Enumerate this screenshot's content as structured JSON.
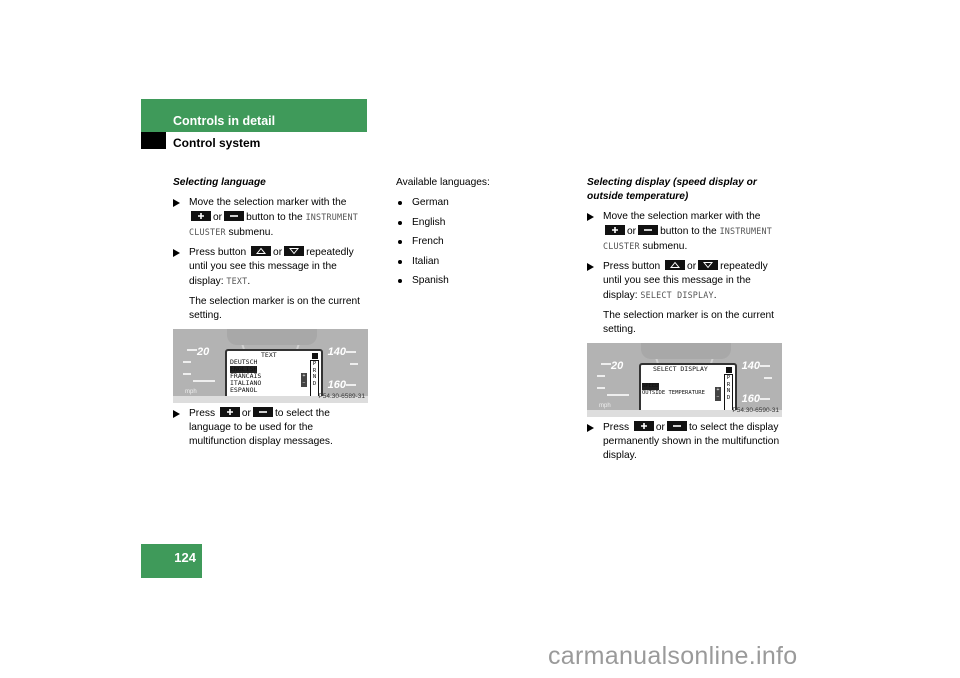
{
  "header": {
    "section_title": "Controls in detail",
    "subsection_title": "Control system"
  },
  "page_number": "124",
  "colors": {
    "accent_green": "#3f9a5a"
  },
  "left_column": {
    "heading": "Selecting language",
    "step1": {
      "pre": "Move the selection marker with the",
      "or": "or",
      "post": "button to the",
      "mono": "INSTRUMENT CLUSTER",
      "tail": "submenu."
    },
    "step2": {
      "pre": "Press button",
      "or": "or",
      "post": "repeatedly until you see this message in the display:",
      "mono": "TEXT",
      "tail": "."
    },
    "note": "The selection marker is on the current setting.",
    "figure": {
      "speed_20": "20",
      "speed_140": "140",
      "speed_160": "160",
      "unit": "mph",
      "display_title": "TEXT",
      "options": [
        "DEUTSCH",
        "ENGLISH",
        "FRANCAIS",
        "ITALIANO",
        "ESPANOL"
      ],
      "selected_option": "ENGLISH",
      "gear": [
        "P",
        "R",
        "N",
        "D"
      ],
      "code": "P54.30-6589-31"
    },
    "step3": {
      "pre": "Press",
      "or": "or",
      "post": "to select the language to be used for the multifunction display messages."
    }
  },
  "middle_column": {
    "heading": "Available languages:",
    "languages": [
      "German",
      "English",
      "French",
      "Italian",
      "Spanish"
    ]
  },
  "right_column": {
    "heading": "Selecting display (speed display or outside temperature)",
    "step1": {
      "pre": "Move the selection marker with the",
      "or": "or",
      "post": "button to the",
      "mono": "INSTRUMENT CLUSTER",
      "tail": "submenu."
    },
    "step2": {
      "pre": "Press button",
      "or": "or",
      "post": "repeatedly until you see this message in the display:",
      "mono": "SELECT DISPLAY",
      "tail": "."
    },
    "note": "The selection marker is on the current setting.",
    "figure": {
      "speed_20": "20",
      "speed_140": "140",
      "speed_160": "160",
      "unit": "mph",
      "display_title": "SELECT DISPLAY",
      "options": [
        "SPEED",
        "OUTSIDE TEMPERATURE"
      ],
      "selected_option": "SPEED",
      "gear": [
        "P",
        "R",
        "N",
        "D"
      ],
      "code": "P54.30-6590-31"
    },
    "step3": {
      "pre": "Press",
      "or": "or",
      "post": "to select the display permanently shown in the multifunction display."
    }
  },
  "icons": {
    "plus": "plus-button-icon",
    "minus": "minus-button-icon",
    "up": "up-arrow-button-icon",
    "down": "down-arrow-button-icon",
    "step_marker": "triangle-bullet-icon"
  },
  "watermark": "carmanualsonline.info"
}
